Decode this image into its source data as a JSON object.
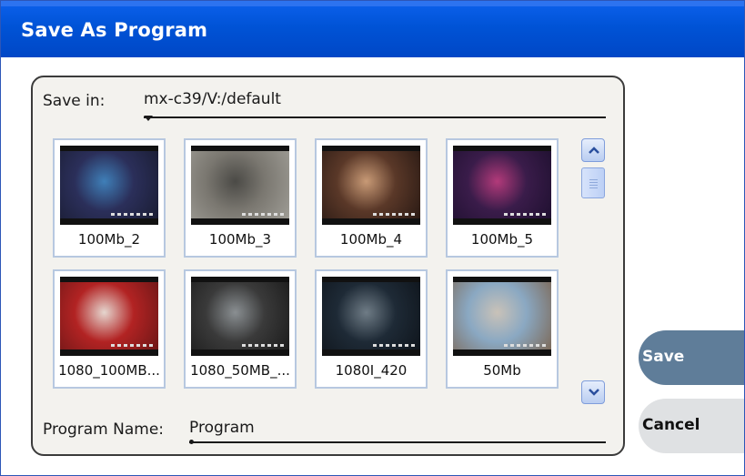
{
  "window": {
    "title": "Save As Program"
  },
  "save_in": {
    "label": "Save in:",
    "path": "mx-c39/V:/default"
  },
  "clips": [
    {
      "name": "100Mb_2",
      "thumb_colors": [
        "#2b2f5a",
        "#3f7fb8",
        "#1a1d33"
      ]
    },
    {
      "name": "100Mb_3",
      "thumb_colors": [
        "#7a7770",
        "#4b4a46",
        "#9e9c95"
      ]
    },
    {
      "name": "100Mb_4",
      "thumb_colors": [
        "#5a3828",
        "#c89a76",
        "#2a1a14"
      ]
    },
    {
      "name": "100Mb_5",
      "thumb_colors": [
        "#3a1c4a",
        "#b23a7a",
        "#1f1030"
      ]
    },
    {
      "name": "1080_100MB...",
      "thumb_colors": [
        "#b22323",
        "#e5d6cf",
        "#6d1717"
      ]
    },
    {
      "name": "1080_50MB_...",
      "thumb_colors": [
        "#3a3a3a",
        "#8a8f92",
        "#1c1c1c"
      ]
    },
    {
      "name": "1080I_420",
      "thumb_colors": [
        "#1e2a36",
        "#6f7c86",
        "#0f151c"
      ]
    },
    {
      "name": "50Mb",
      "thumb_colors": [
        "#8aa8c2",
        "#c9c2b8",
        "#7d6a5a"
      ]
    }
  ],
  "program_name": {
    "label": "Program Name:",
    "value": "Program"
  },
  "buttons": {
    "save": "Save",
    "cancel": "Cancel"
  },
  "colors": {
    "titlebar": "#0053d6",
    "save_button": "#5f7d99",
    "cancel_button": "#dfe1e3"
  }
}
